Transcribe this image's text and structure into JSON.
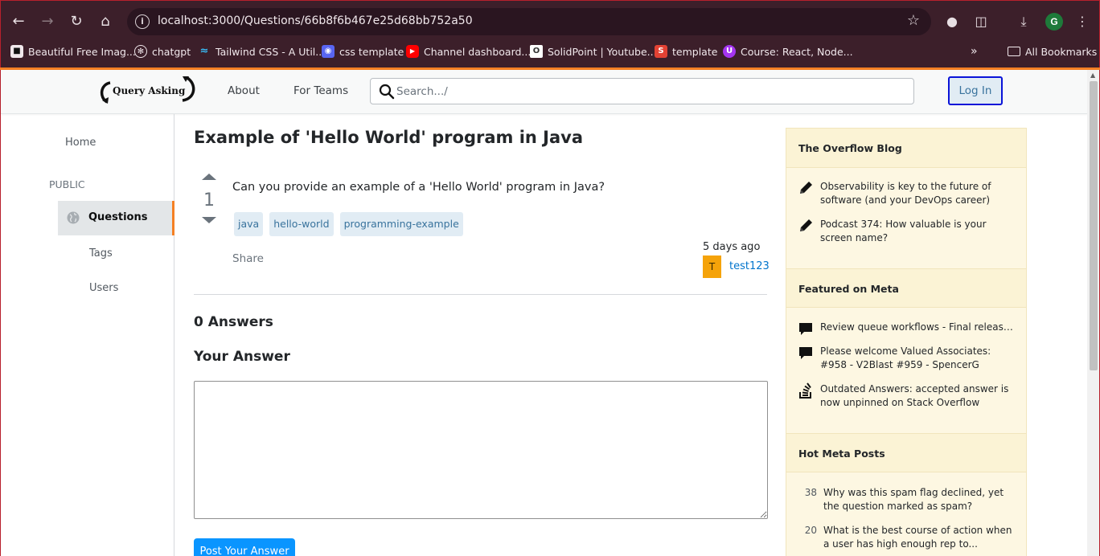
{
  "browser": {
    "url": "localhost:3000/Questions/66b8f6b467e25d68bb752a50",
    "profile_initial": "G",
    "bookmarks": [
      {
        "label": "Beautiful Free Imag...",
        "icon": "unsplash-icon",
        "color": "#111111"
      },
      {
        "label": "chatgpt",
        "icon": "chatgpt-icon",
        "color": "#f1e8ec"
      },
      {
        "label": "Tailwind CSS - A Util...",
        "icon": "tailwind-icon",
        "color": "#38bdf8"
      },
      {
        "label": "css template",
        "icon": "css-template-icon",
        "color": "#5865f2"
      },
      {
        "label": "Channel dashboard...",
        "icon": "youtube-icon",
        "color": "#ff0000"
      },
      {
        "label": "SolidPoint | Youtube...",
        "icon": "solidpoint-icon",
        "color": "#ffffff"
      },
      {
        "label": "template",
        "icon": "template-s-icon",
        "color": "#e34234"
      },
      {
        "label": "Course: React, Node...",
        "icon": "udemy-icon",
        "color": "#a435f0"
      }
    ],
    "all_bookmarks": "All Bookmarks"
  },
  "header": {
    "logo_text": "Query Asking",
    "nav_about": "About",
    "nav_for_teams": "For Teams",
    "search_placeholder": "Search.../",
    "login_label": "Log In"
  },
  "sidebar": {
    "home": "Home",
    "public": "PUBLIC",
    "questions": "Questions",
    "tags": "Tags",
    "users": "Users"
  },
  "question": {
    "title": "Example of 'Hello World' program in Java",
    "votes": "1",
    "body": "Can you provide an example of a 'Hello World' program in Java?",
    "tags": [
      "java",
      "hello-world",
      "programming-example"
    ],
    "share": "Share",
    "asked": "5 days ago",
    "user_initial": "T",
    "user_name": "test123"
  },
  "answers": {
    "count_label": "0 Answers",
    "your_answer_label": "Your Answer",
    "post_button": "Post Your Answer"
  },
  "widget": {
    "blog_title": "The Overflow Blog",
    "blog_items": [
      "Observability is key to the future of software (and your DevOps career)",
      "Podcast 374: How valuable is your screen name?"
    ],
    "meta_title": "Featured on Meta",
    "meta_items": [
      "Review queue workflows - Final release....",
      "Please welcome Valued Associates: #958 - V2Blast #959 - SpencerG",
      "Outdated Answers: accepted answer is now unpinned on Stack Overflow"
    ],
    "hot_title": "Hot Meta Posts",
    "hot_items": [
      {
        "count": "38",
        "text": "Why was this spam flag declined, yet the question marked as spam?"
      },
      {
        "count": "20",
        "text": "What is the best course of action when a user has high enough rep to..."
      }
    ]
  },
  "colors": {
    "accent_orange": "#f48024",
    "link_blue": "#0074cc",
    "tag_bg": "#e1ecf4",
    "tag_text": "#39739d",
    "widget_bg": "#fdf7e2",
    "post_button": "#0a95ff",
    "login_border": "#0a14d8"
  }
}
